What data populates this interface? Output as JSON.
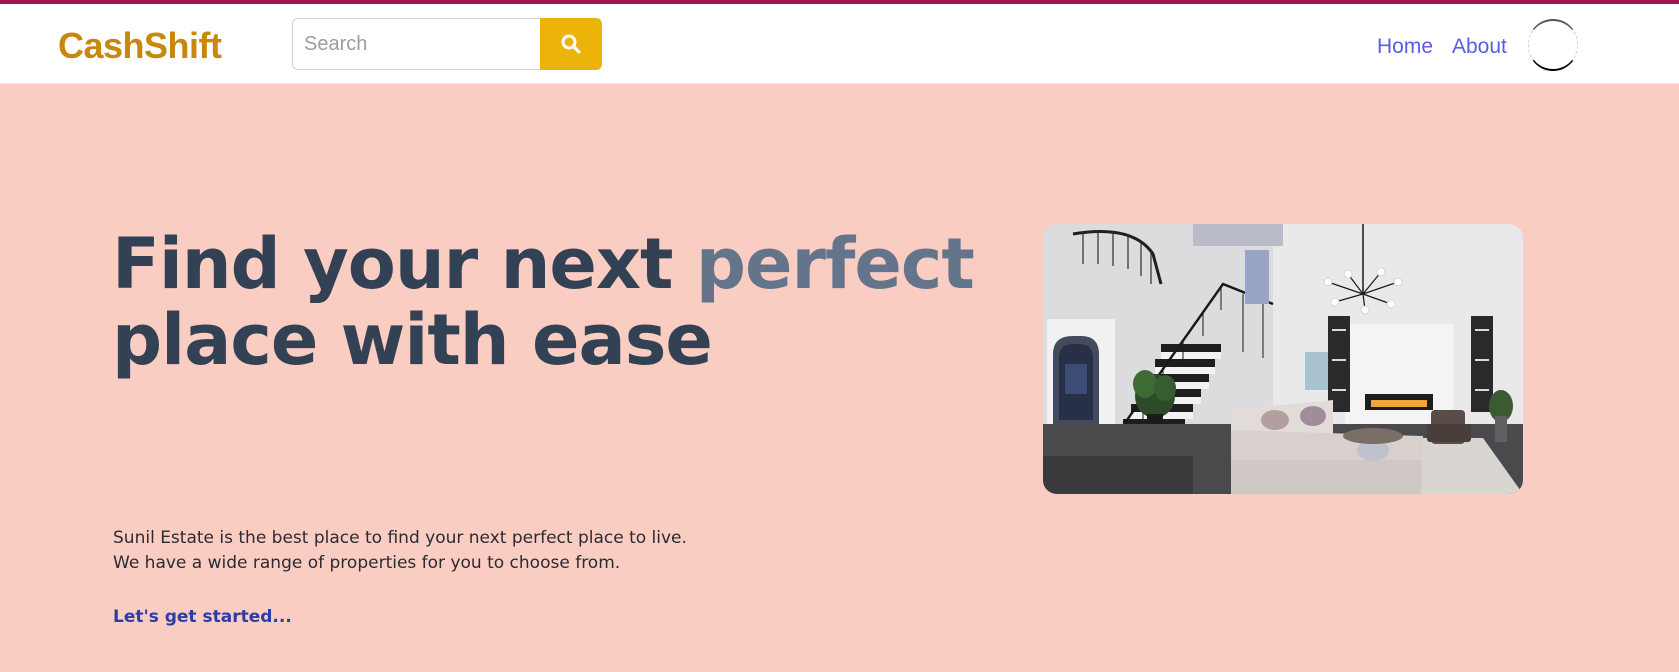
{
  "colors": {
    "top_accent": "#a0174f",
    "brand": "#c8870d",
    "search_button": "#ecb308",
    "nav_link": "#5b5ce6",
    "heading_dark": "#334155",
    "heading_accent": "#64748b",
    "cta": "#2a3ea8",
    "page_background": "#f9cdc2"
  },
  "navbar": {
    "logo": "CashShift",
    "search": {
      "placeholder": "Search",
      "value": "",
      "button_icon": "search-icon"
    },
    "links": [
      {
        "label": "Home"
      },
      {
        "label": "About"
      }
    ],
    "profile_icon": "avatar"
  },
  "hero": {
    "title_part1": "Find your next ",
    "title_highlight": "perfect",
    "title_part2": "place with ease",
    "description_line1": "Sunil Estate is the best place to find your next perfect place to live.",
    "description_line2": "We have a wide range of properties for you to choose from.",
    "cta_label": "Let's get started..."
  }
}
